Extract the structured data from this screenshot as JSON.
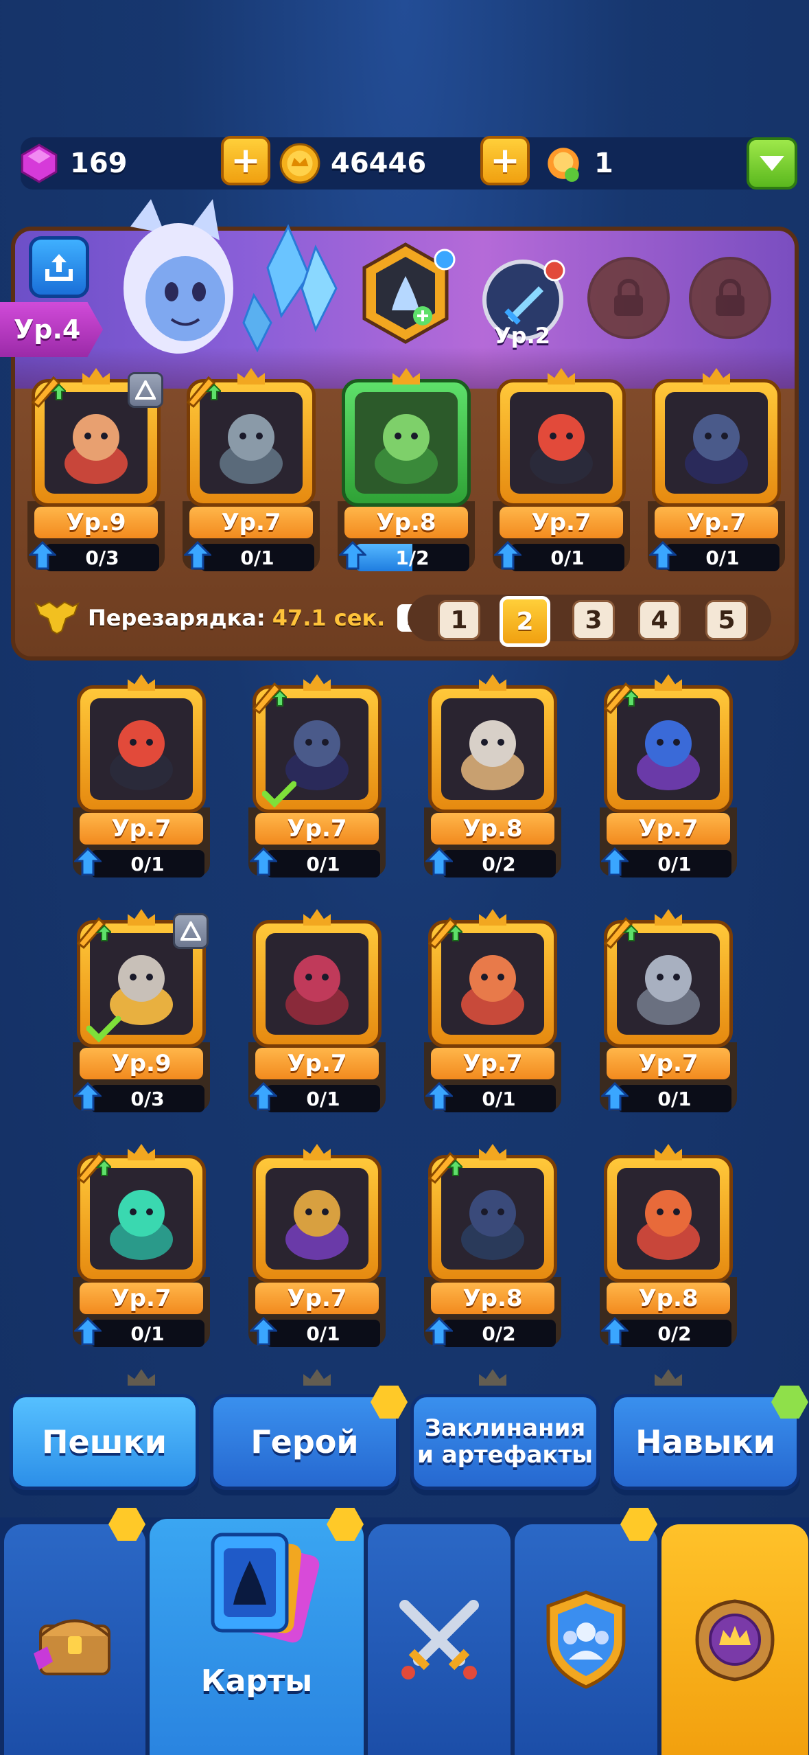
{
  "resources": {
    "gems": "169",
    "coins": "46446",
    "tokens": "1"
  },
  "deck": {
    "level_label": "Ур.4",
    "skill_level": "Ур.2",
    "recharge_label": "Перезарядка:",
    "recharge_value": "47.1 сек.",
    "deck_tabs": [
      "1",
      "2",
      "3",
      "4",
      "5"
    ],
    "active_tab": "2",
    "cards": [
      {
        "level": "Ур.9",
        "progress": "0/3",
        "fill": 0
      },
      {
        "level": "Ур.7",
        "progress": "0/1",
        "fill": 0
      },
      {
        "level": "Ур.8",
        "progress": "1/2",
        "fill": 0.5
      },
      {
        "level": "Ур.7",
        "progress": "0/1",
        "fill": 0
      },
      {
        "level": "Ур.7",
        "progress": "0/1",
        "fill": 0
      }
    ]
  },
  "collection": {
    "rows": [
      [
        {
          "level": "Ур.7",
          "progress": "0/1"
        },
        {
          "level": "Ур.7",
          "progress": "0/1"
        },
        {
          "level": "Ур.8",
          "progress": "0/2"
        },
        {
          "level": "Ур.7",
          "progress": "0/1"
        }
      ],
      [
        {
          "level": "Ур.9",
          "progress": "0/3"
        },
        {
          "level": "Ур.7",
          "progress": "0/1"
        },
        {
          "level": "Ур.7",
          "progress": "0/1"
        },
        {
          "level": "Ур.7",
          "progress": "0/1"
        }
      ],
      [
        {
          "level": "Ур.7",
          "progress": "0/1"
        },
        {
          "level": "Ур.7",
          "progress": "0/1"
        },
        {
          "level": "Ур.8",
          "progress": "0/2"
        },
        {
          "level": "Ур.8",
          "progress": "0/2"
        }
      ]
    ]
  },
  "categories": {
    "pawns": "Пешки",
    "hero": "Герой",
    "spells_line1": "Заклинания",
    "spells_line2": "и артефакты",
    "skills": "Навыки"
  },
  "nav": {
    "cards": "Карты"
  },
  "colors": {
    "accent_gold": "#f2a720",
    "accent_blue": "#2a84e0",
    "background": "#173a78"
  }
}
